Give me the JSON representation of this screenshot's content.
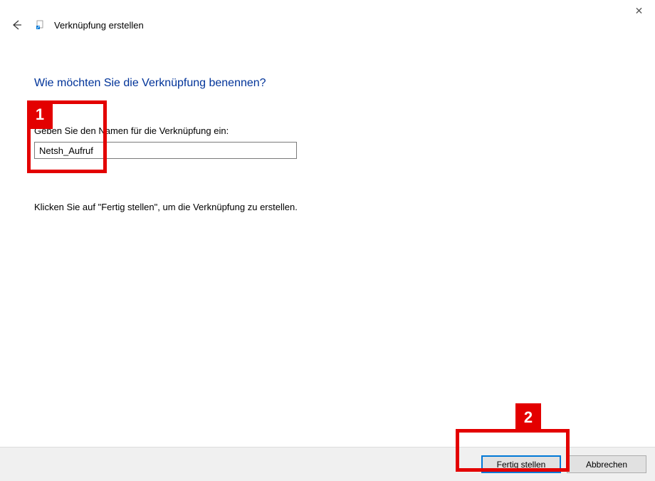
{
  "titlebar": {
    "close_glyph": "✕"
  },
  "header": {
    "back_glyph": "←",
    "icon_glyph": "▫",
    "page_title": "Verknüpfung erstellen"
  },
  "main": {
    "heading": "Wie möchten Sie die Verknüpfung benennen?",
    "field_label": "Geben Sie den Namen für die Verknüpfung ein:",
    "name_value": "Netsh_Aufruf",
    "instruction": "Klicken Sie auf \"Fertig stellen\", um die Verknüpfung zu erstellen."
  },
  "footer": {
    "finish_label": "Fertig stellen",
    "cancel_label": "Abbrechen"
  },
  "annotations": {
    "badge1": "1",
    "badge2": "2"
  }
}
